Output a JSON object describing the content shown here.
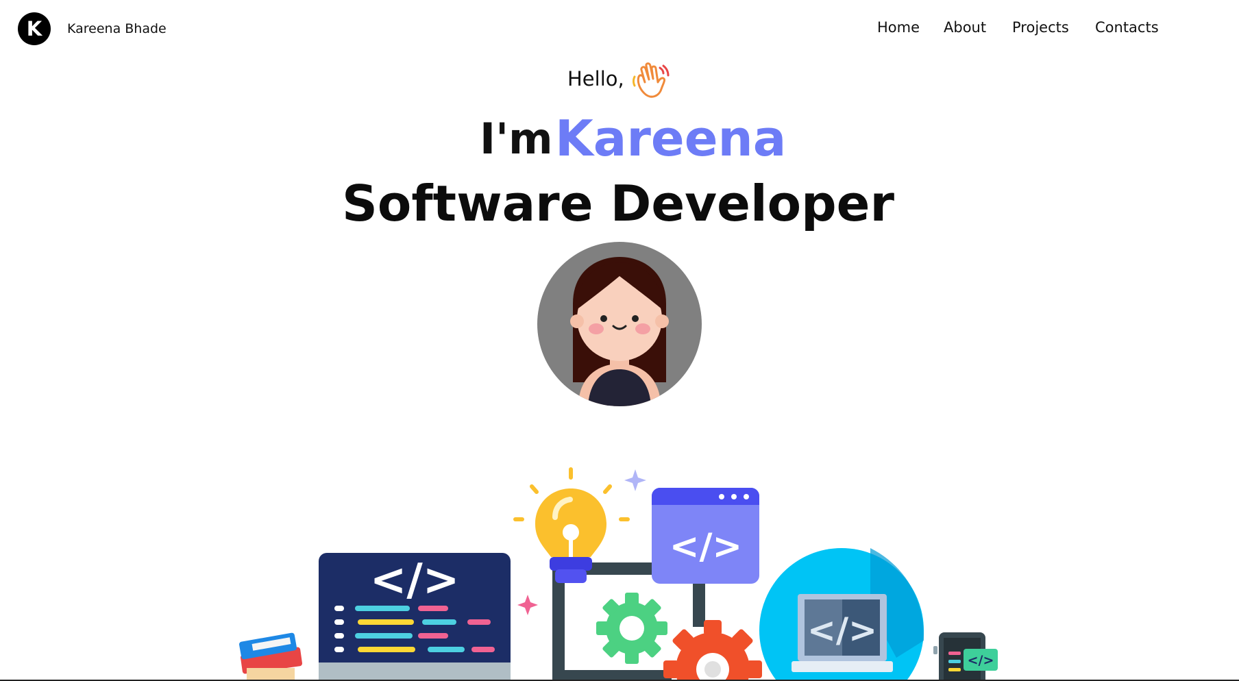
{
  "header": {
    "logo_letter": "K",
    "brand_name": "Kareena Bhade"
  },
  "nav": {
    "items": [
      {
        "label": "Home"
      },
      {
        "label": "About"
      },
      {
        "label": "Projects"
      },
      {
        "label": "Contacts"
      }
    ]
  },
  "hero": {
    "greeting": "Hello,",
    "intro": "I'm",
    "name": "Kareena",
    "role": "Software Developer"
  },
  "illustration": {
    "code_symbol": "</>"
  },
  "colors": {
    "accent": "#6d7cf6",
    "avatar_bg": "#808080",
    "logo_bg": "#000000"
  }
}
